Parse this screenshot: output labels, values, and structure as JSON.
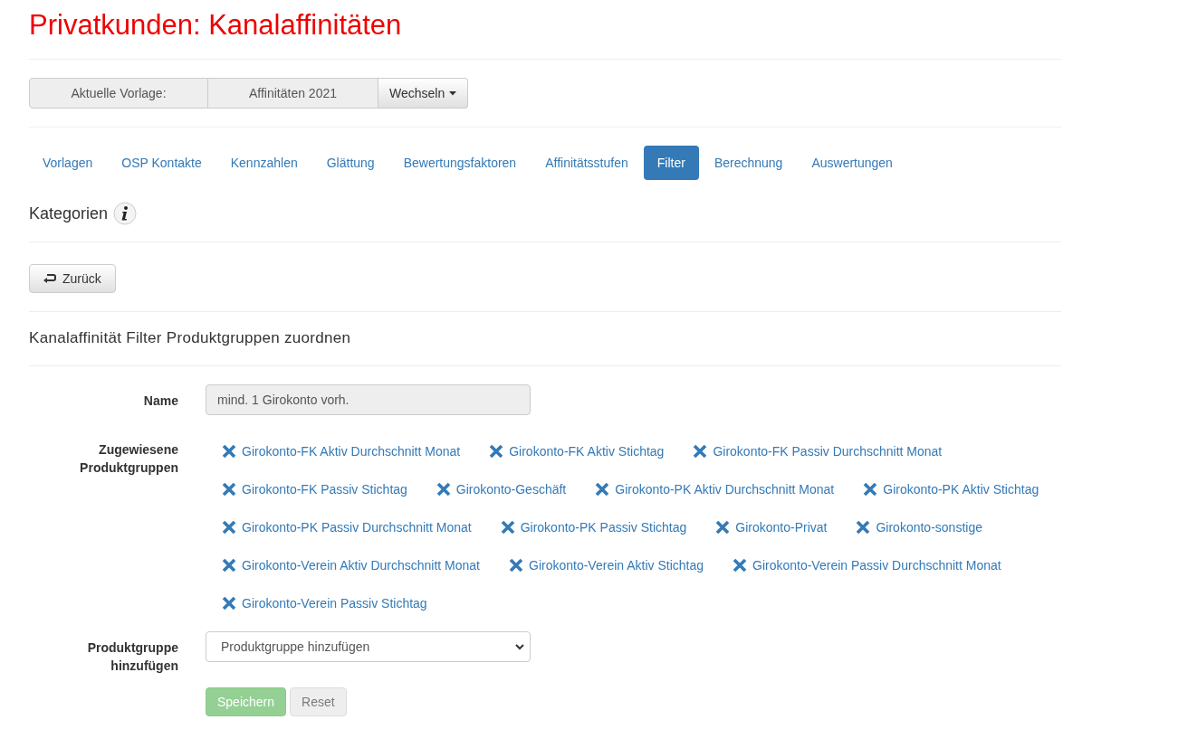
{
  "title": "Privatkunden: Kanalaffinitäten",
  "template_bar": {
    "label": "Aktuelle Vorlage:",
    "value": "Affinitäten 2021",
    "switch_button": "Wechseln"
  },
  "tabs": [
    {
      "label": "Vorlagen",
      "selected": false
    },
    {
      "label": "OSP Kontakte",
      "selected": false
    },
    {
      "label": "Kennzahlen",
      "selected": false
    },
    {
      "label": "Glättung",
      "selected": false
    },
    {
      "label": "Bewertungsfaktoren",
      "selected": false
    },
    {
      "label": "Affinitätsstufen",
      "selected": false
    },
    {
      "label": "Filter",
      "selected": true
    },
    {
      "label": "Berechnung",
      "selected": false
    },
    {
      "label": "Auswertungen",
      "selected": false
    }
  ],
  "section_title": "Kategorien",
  "back_button": "Zurück",
  "form_title": "Kanalaffinität Filter Produktgruppen zuordnen",
  "name_field": {
    "label": "Name",
    "value": "mind. 1 Girokonto vorh.",
    "disabled": true
  },
  "assigned": {
    "label": "Zugewiesene Produktgruppen",
    "items": [
      "Girokonto-FK Aktiv Durchschnitt Monat",
      "Girokonto-FK Aktiv Stichtag",
      "Girokonto-FK Passiv Durchschnitt Monat",
      "Girokonto-FK Passiv Stichtag",
      "Girokonto-Geschäft",
      "Girokonto-PK Aktiv Durchschnitt Monat",
      "Girokonto-PK Aktiv Stichtag",
      "Girokonto-PK Passiv Durchschnitt Monat",
      "Girokonto-PK Passiv Stichtag",
      "Girokonto-Privat",
      "Girokonto-sonstige",
      "Girokonto-Verein Aktiv Durchschnitt Monat",
      "Girokonto-Verein Aktiv Stichtag",
      "Girokonto-Verein Passiv Durchschnitt Monat",
      "Girokonto-Verein Passiv Stichtag"
    ]
  },
  "add_field": {
    "label": "Produktgruppe hinzufügen",
    "value": "Produktgruppe hinzufügen"
  },
  "buttons": [
    {
      "label": "Speichern",
      "kind": "primary",
      "disabled": true
    },
    {
      "label": "Reset",
      "kind": "default",
      "disabled": true
    }
  ]
}
